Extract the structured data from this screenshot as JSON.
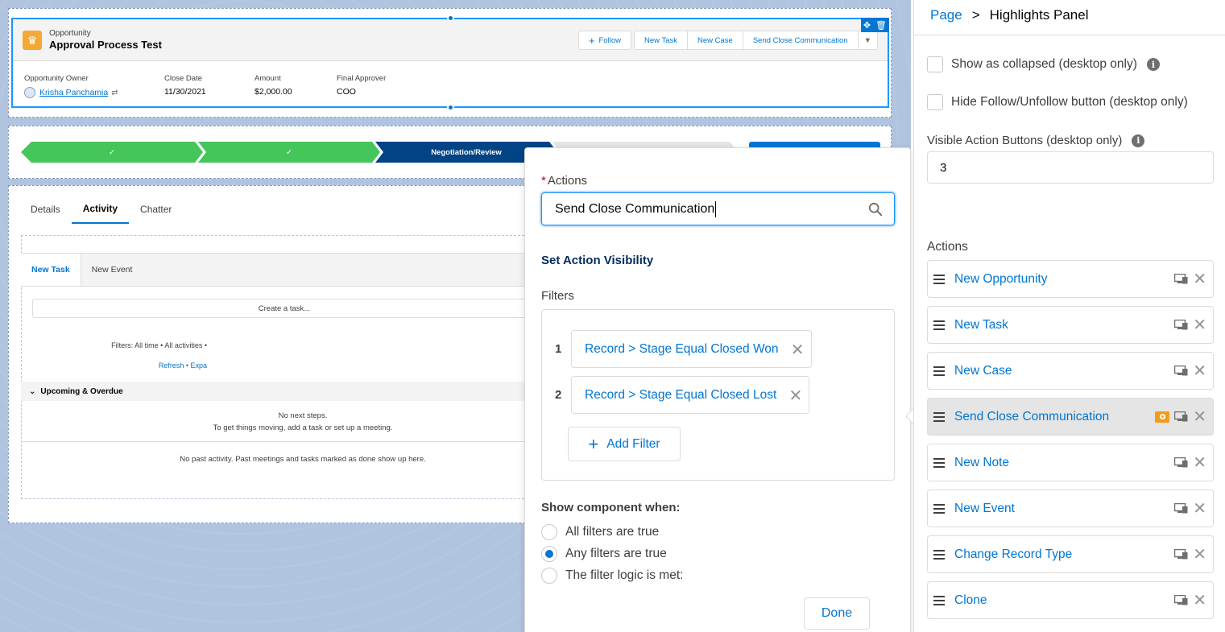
{
  "record": {
    "object_label": "Opportunity",
    "title": "Approval Process Test",
    "buttons": {
      "follow": "Follow",
      "new_task": "New Task",
      "new_case": "New Case",
      "send_close": "Send Close Communication"
    },
    "fields": [
      {
        "label": "Opportunity Owner",
        "value": "Krisha Panchamia"
      },
      {
        "label": "Close Date",
        "value": "11/30/2021"
      },
      {
        "label": "Amount",
        "value": "$2,000.00"
      },
      {
        "label": "Final Approver",
        "value": "COO"
      }
    ]
  },
  "path": {
    "current_stage": "Negotiation/Review",
    "done_mark": "✓"
  },
  "tabs": [
    "Details",
    "Activity",
    "Chatter"
  ],
  "activity": {
    "publisher_tabs": [
      "New Task",
      "New Event"
    ],
    "task_placeholder": "Create a task...",
    "filters_text": "Filters: All time • All activities •",
    "refresh_text": "Refresh • Expa",
    "upcoming_label": "Upcoming & Overdue",
    "next_steps_1": "No next steps.",
    "next_steps_2": "To get things moving, add a task or set up a meeting.",
    "past_activity": "No past activity. Past meetings and tasks marked as done show up here."
  },
  "popover": {
    "actions_label": "Actions",
    "search_value": "Send Close Communication",
    "heading": "Set Action Visibility",
    "filters_label": "Filters",
    "filters": [
      {
        "num": "1",
        "text": "Record > Stage Equal Closed Won"
      },
      {
        "num": "2",
        "text": "Record > Stage Equal Closed Lost"
      }
    ],
    "add_filter": "Add Filter",
    "show_when": "Show component when:",
    "radios": [
      {
        "label": "All filters are true",
        "checked": false
      },
      {
        "label": "Any filters are true",
        "checked": true
      },
      {
        "label": "The filter logic is met:",
        "checked": false
      }
    ],
    "done": "Done"
  },
  "panel": {
    "breadcrumb_page": "Page",
    "breadcrumb_sep": ">",
    "breadcrumb_current": "Highlights Panel",
    "show_collapsed": "Show as collapsed (desktop only)",
    "hide_follow": "Hide Follow/Unfollow button (desktop only)",
    "visible_buttons_label": "Visible Action Buttons (desktop only)",
    "visible_buttons_value": "3",
    "actions_label": "Actions",
    "actions": [
      "New Opportunity",
      "New Task",
      "New Case",
      "Send Close Communication",
      "New Note",
      "New Event",
      "Change Record Type",
      "Clone"
    ],
    "selected_action": "Send Close Communication"
  },
  "colors": {
    "brand": "#0176d3",
    "path_done": "#45c65a",
    "path_current": "#014486",
    "record_icon": "#f4a935",
    "visibility_icon": "#f59b1a"
  }
}
